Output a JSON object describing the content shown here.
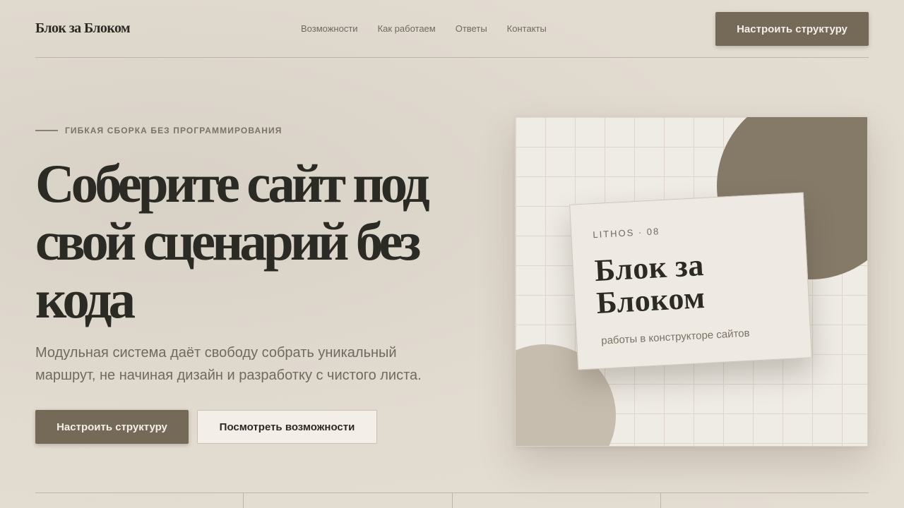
{
  "header": {
    "logo": "Блок за Блоком",
    "nav": [
      "Возможности",
      "Как работаем",
      "Ответы",
      "Контакты"
    ],
    "cta_label": "Настроить структуру"
  },
  "hero": {
    "eyebrow": "ГИБКАЯ СБОРКА БЕЗ ПРОГРАММИРОВАНИЯ",
    "title": "Соберите сайт под свой сценарий без кода",
    "subtitle": "Модульная система даёт свободу собрать уникальный маршрут, не начиная дизайн и разработку с чистого листа.",
    "primary_button": "Настроить структуру",
    "secondary_button": "Посмотреть возможности"
  },
  "visual": {
    "card_eyebrow": "LITHOS · 08",
    "card_title": "Блок за Блоком",
    "card_subtitle": "работы в конструкторе сайтов"
  },
  "colors": {
    "background": "#e2dbd0",
    "accent": "#756a58",
    "text": "#2b2a24",
    "muted": "#6f6a5f"
  }
}
